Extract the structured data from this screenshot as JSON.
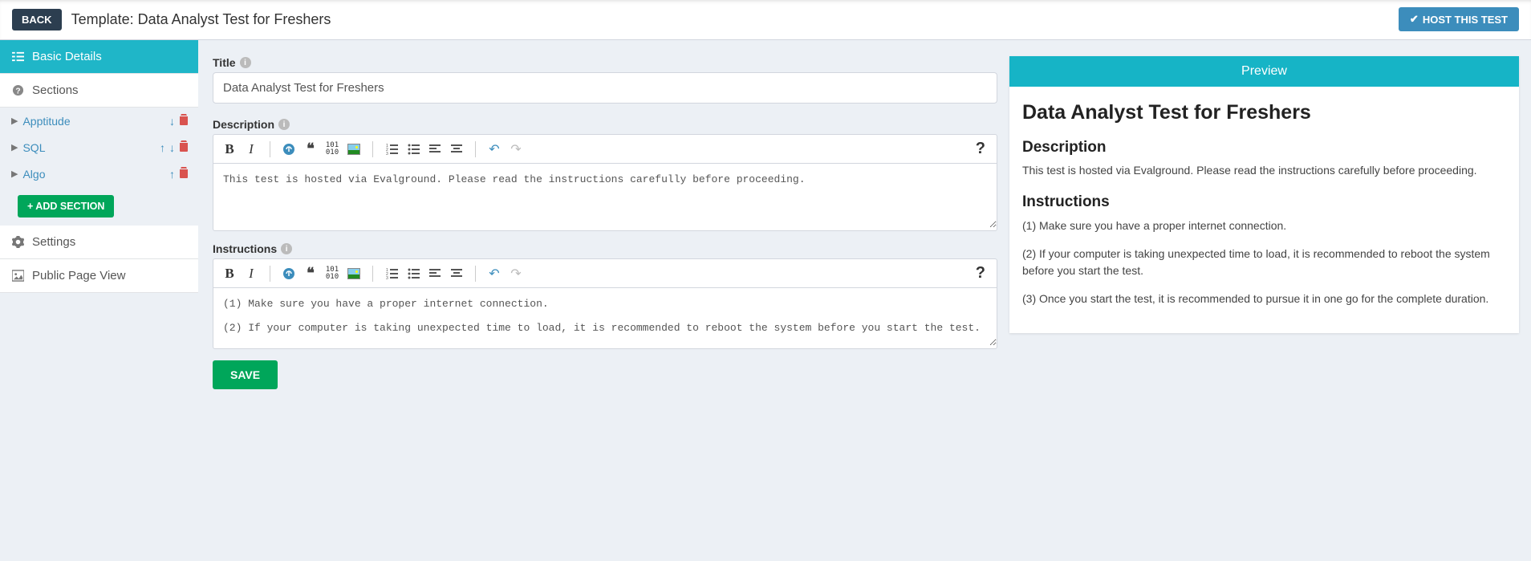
{
  "topbar": {
    "back": "BACK",
    "page_title": "Template: Data Analyst Test for Freshers",
    "host": "HOST THIS TEST"
  },
  "sidebar": {
    "basic_details": "Basic Details",
    "sections_label": "Sections",
    "sections": [
      {
        "name": "Apptitude",
        "up": false,
        "down": true
      },
      {
        "name": "SQL",
        "up": true,
        "down": true
      },
      {
        "name": "Algo",
        "up": true,
        "down": false
      }
    ],
    "add_section": "+ ADD SECTION",
    "settings": "Settings",
    "public_page": "Public Page View"
  },
  "form": {
    "title_label": "Title",
    "title_value": "Data Analyst Test for Freshers",
    "description_label": "Description",
    "description_value": "This test is hosted via Evalground. Please read the instructions carefully before proceeding.",
    "instructions_label": "Instructions",
    "instructions_value": "(1) Make sure you have a proper internet connection.\n\n(2) If your computer is taking unexpected time to load, it is recommended to reboot the system before you start the test.",
    "save": "SAVE"
  },
  "preview": {
    "header": "Preview",
    "title": "Data Analyst Test for Freshers",
    "desc_heading": "Description",
    "desc_text": "This test is hosted via Evalground. Please read the instructions carefully before proceeding.",
    "inst_heading": "Instructions",
    "inst_1": "(1) Make sure you have a proper internet connection.",
    "inst_2": "(2) If your computer is taking unexpected time to load, it is recommended to reboot the system before you start the test.",
    "inst_3": "(3) Once you start the test, it is recommended to pursue it in one go for the complete duration."
  },
  "icons": {
    "check": "✔",
    "list": "≡",
    "help": "?",
    "gear": "⚙",
    "image": "🖼",
    "caret": "▶",
    "trash": "🗑",
    "up": "↑",
    "down": "↓"
  }
}
